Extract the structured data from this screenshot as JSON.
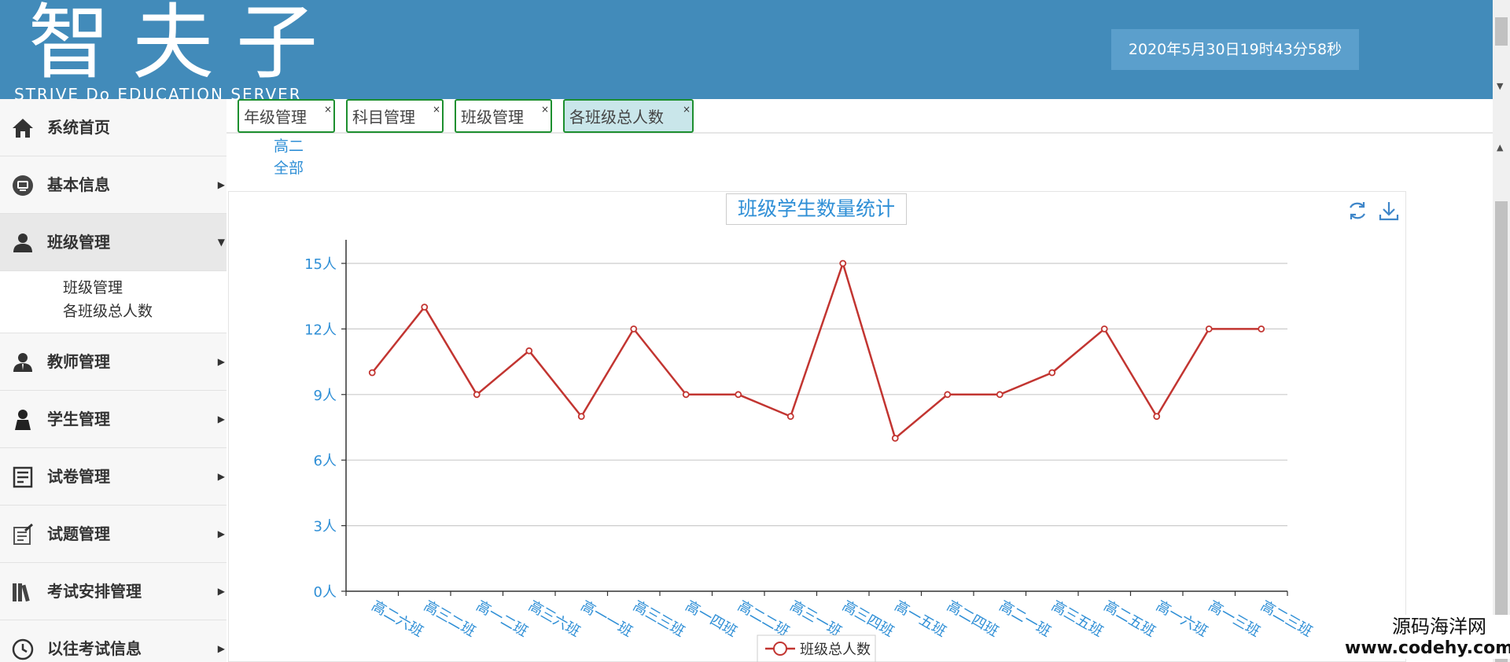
{
  "header": {
    "logo_title": "智夫子",
    "logo_subtitle": "STRIVE Do EDUCATION SERVER",
    "datetime": "2020年5月30日19时43分58秒"
  },
  "sidebar": {
    "items": [
      {
        "label": "系统首页",
        "icon": "home-icon"
      },
      {
        "label": "基本信息",
        "icon": "info-icon"
      },
      {
        "label": "班级管理",
        "icon": "class-icon"
      },
      {
        "label": "教师管理",
        "icon": "teacher-icon"
      },
      {
        "label": "学生管理",
        "icon": "student-icon"
      },
      {
        "label": "试卷管理",
        "icon": "paper-icon"
      },
      {
        "label": "试题管理",
        "icon": "question-icon"
      },
      {
        "label": "考试安排管理",
        "icon": "books-icon"
      },
      {
        "label": "以往考试信息",
        "icon": "clock-icon"
      }
    ],
    "submenu": [
      "班级管理",
      "各班级总人数"
    ]
  },
  "tabs": [
    {
      "label": "年级管理",
      "close": "×"
    },
    {
      "label": "科目管理",
      "close": "×"
    },
    {
      "label": "班级管理",
      "close": "×"
    },
    {
      "label": "各班级总人数",
      "close": "×"
    }
  ],
  "filters": [
    "高二",
    "全部"
  ],
  "chart_data": {
    "type": "line",
    "title": "班级学生数量统计",
    "categories": [
      "高二六班",
      "高三二班",
      "高一二班",
      "高三六班",
      "高一一班",
      "高三三班",
      "高一四班",
      "高二二班",
      "高三一班",
      "高三四班",
      "高一五班",
      "高二四班",
      "高二一班",
      "高三五班",
      "高二五班",
      "高一六班",
      "高一三班",
      "高二三班"
    ],
    "series": [
      {
        "name": "班级总人数",
        "values": [
          10,
          13,
          9,
          11,
          8,
          12,
          9,
          9,
          8,
          15,
          7,
          9,
          9,
          10,
          12,
          8,
          12,
          12
        ],
        "color": "#c23531"
      }
    ],
    "y_ticks": [
      "0人",
      "3人",
      "6人",
      "9人",
      "12人",
      "15人"
    ],
    "ylim": [
      0,
      15
    ],
    "grid": true,
    "legend_position": "bottom-center"
  },
  "watermark": {
    "cn": "源码海洋网",
    "en": "www.codehy.com"
  }
}
